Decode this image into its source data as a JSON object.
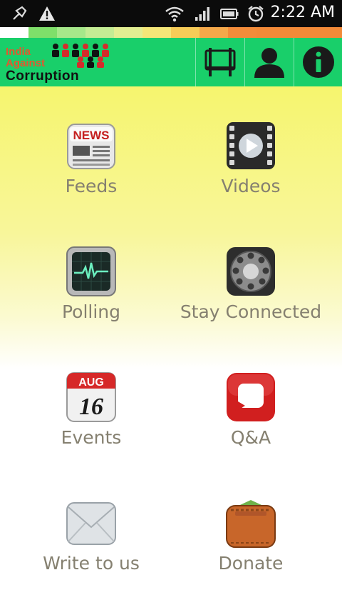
{
  "status_bar": {
    "time": "2:22 AM",
    "icons": [
      "usb-debug-icon",
      "warning-icon",
      "wifi-icon",
      "signal-icon",
      "battery-icon",
      "alarm-icon"
    ]
  },
  "header": {
    "logo_line1": "India",
    "logo_line2": "Against",
    "logo_line3": "Corruption",
    "buttons": [
      "board-icon",
      "profile-icon",
      "info-icon"
    ]
  },
  "menu": [
    {
      "label": "Feeds",
      "icon": "news-icon"
    },
    {
      "label": "Videos",
      "icon": "film-icon"
    },
    {
      "label": "Polling",
      "icon": "monitor-icon"
    },
    {
      "label": "Stay Connected",
      "icon": "rotary-phone-icon"
    },
    {
      "label": "Events",
      "icon": "calendar-icon",
      "month": "AUG",
      "day": "16"
    },
    {
      "label": "Q&A",
      "icon": "speech-bubble-icon"
    },
    {
      "label": "Write to us",
      "icon": "envelope-icon"
    },
    {
      "label": "Donate",
      "icon": "wallet-icon"
    }
  ],
  "colors": {
    "header_green": "#19cf6a",
    "label_gray": "#858070"
  }
}
